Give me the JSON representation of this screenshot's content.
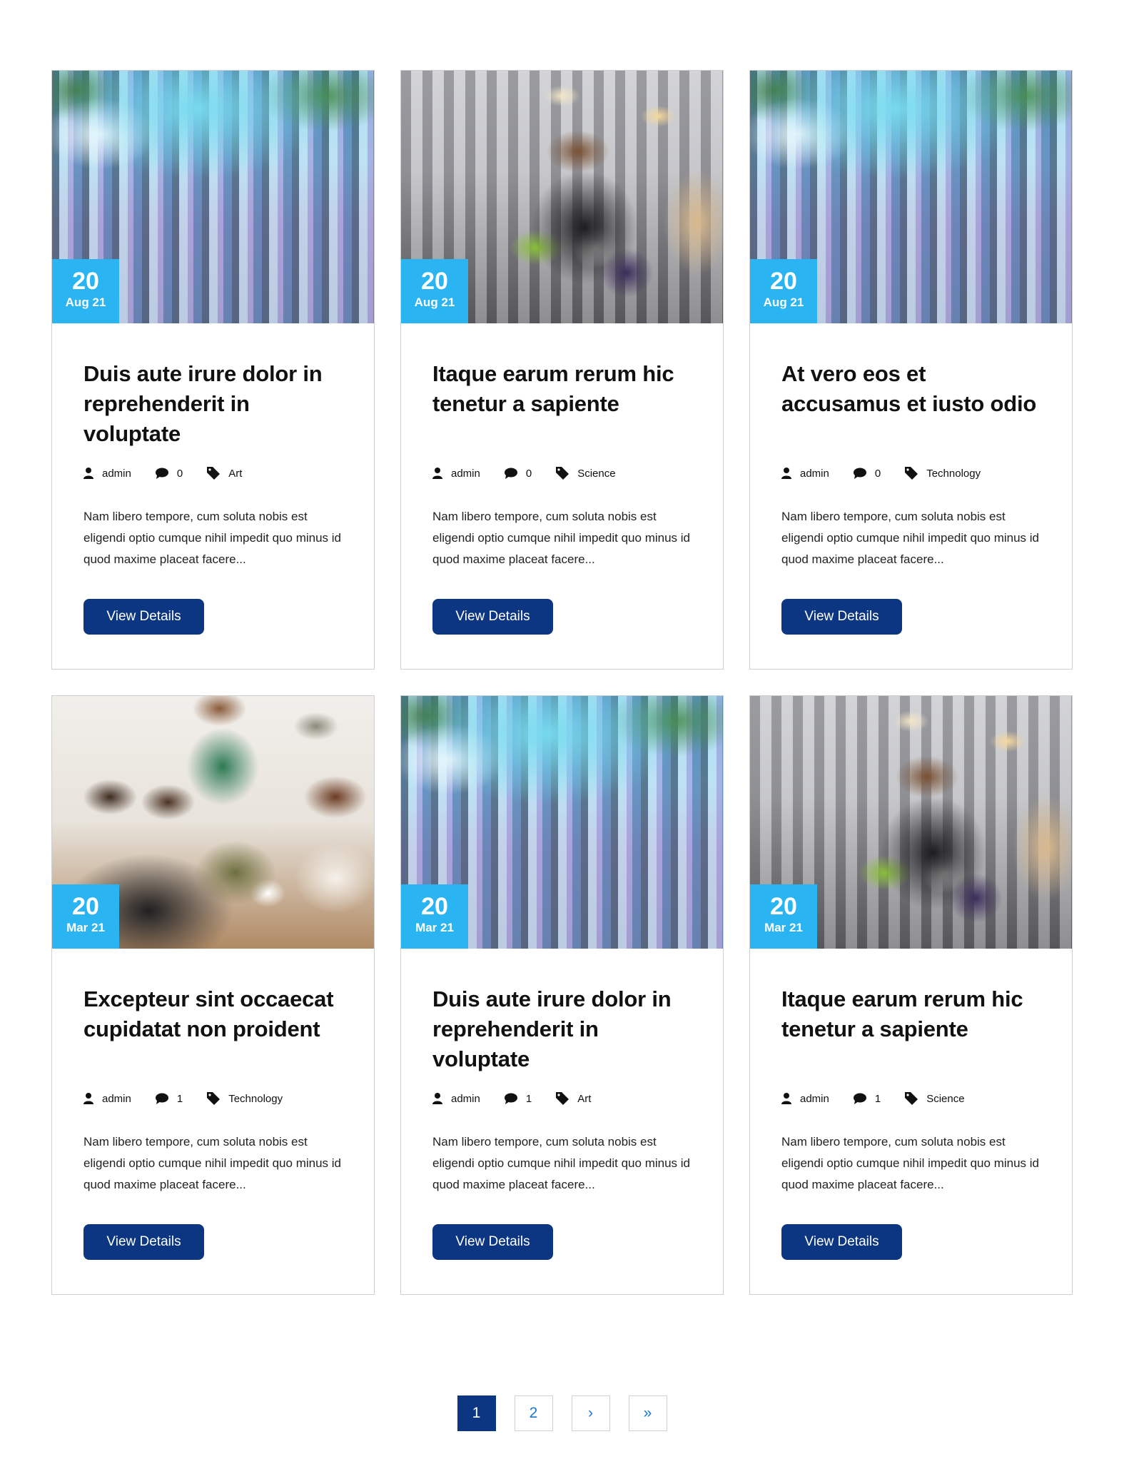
{
  "posts": [
    {
      "image": "festival-crowd-photo",
      "date_day": "20",
      "date_month": "Aug 21",
      "title": "Duis aute irure dolor in reprehenderit in voluptate",
      "author": "admin",
      "comments": "0",
      "category": "Art",
      "excerpt": "Nam libero tempore, cum soluta nobis est eligendi optio cumque nihil impedit quo minus id quod maxime placeat facere...",
      "button": "View Details"
    },
    {
      "image": "student-with-plant-photo",
      "date_day": "20",
      "date_month": "Aug 21",
      "title": "Itaque earum rerum hic tenetur a sapiente",
      "author": "admin",
      "comments": "0",
      "category": "Science",
      "excerpt": "Nam libero tempore, cum soluta nobis est eligendi optio cumque nihil impedit quo minus id quod maxime placeat facere...",
      "button": "View Details"
    },
    {
      "image": "festival-crowd-photo",
      "date_day": "20",
      "date_month": "Aug 21",
      "title": "At vero eos et accusamus et iusto odio",
      "author": "admin",
      "comments": "0",
      "category": "Technology",
      "excerpt": "Nam libero tempore, cum soluta nobis est eligendi optio cumque nihil impedit quo minus id quod maxime placeat facere...",
      "button": "View Details"
    },
    {
      "image": "group-laptop-photo",
      "date_day": "20",
      "date_month": "Mar 21",
      "title": "Excepteur sint occaecat cupidatat non proident",
      "author": "admin",
      "comments": "1",
      "category": "Technology",
      "excerpt": "Nam libero tempore, cum soluta nobis est eligendi optio cumque nihil impedit quo minus id quod maxime placeat facere...",
      "button": "View Details"
    },
    {
      "image": "festival-crowd-photo",
      "date_day": "20",
      "date_month": "Mar 21",
      "title": "Duis aute irure dolor in reprehenderit in voluptate",
      "author": "admin",
      "comments": "1",
      "category": "Art",
      "excerpt": "Nam libero tempore, cum soluta nobis est eligendi optio cumque nihil impedit quo minus id quod maxime placeat facere...",
      "button": "View Details"
    },
    {
      "image": "student-with-plant-photo",
      "date_day": "20",
      "date_month": "Mar 21",
      "title": "Itaque earum rerum hic tenetur a sapiente",
      "author": "admin",
      "comments": "1",
      "category": "Science",
      "excerpt": "Nam libero tempore, cum soluta nobis est eligendi optio cumque nihil impedit quo minus id quod maxime placeat facere...",
      "button": "View Details"
    }
  ],
  "pagination": {
    "current": "1",
    "next_page": "2",
    "next": "›",
    "last": "»"
  },
  "icons": {
    "author": "user-icon",
    "comments": "comment-icon",
    "category": "tag-icon"
  },
  "colors": {
    "date_badge": "#2ab4f2",
    "button": "#0c3682",
    "page_link": "#1a78d0"
  }
}
